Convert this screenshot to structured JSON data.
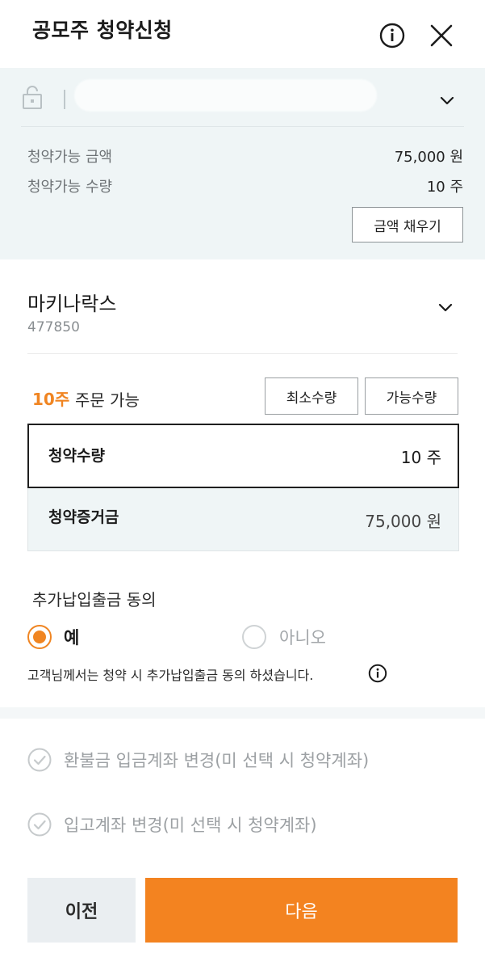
{
  "header": {
    "title": "공모주 청약신청",
    "info_icon": "info-circle-icon",
    "close_icon": "close-icon"
  },
  "account": {
    "icon": "lock-icon",
    "chevron": "chevron-down-icon",
    "rows": [
      {
        "label": "청약가능 금액",
        "value": "75,000 원"
      },
      {
        "label": "청약가능 수량",
        "value": "10 주"
      }
    ],
    "fill_button": "금액 채우기"
  },
  "stock": {
    "name": "마키나락스",
    "code": "477850",
    "chevron": "chevron-down-icon"
  },
  "order": {
    "available_qty": "10주",
    "available_text": "주문 가능",
    "min_button": "최소수량",
    "max_button": "가능수량",
    "quantity_label": "청약수량",
    "quantity_value": "10 주",
    "deposit_label": "청약증거금",
    "deposit_value": "75,000 원"
  },
  "consent": {
    "title": "추가납입출금 동의",
    "yes": "예",
    "no": "아니오",
    "selected": "예",
    "note": "고객님께서는 청약 시 추가납입출금 동의 하셨습니다.",
    "note_icon": "info-circle-icon"
  },
  "options": [
    {
      "label": "환불금 입금계좌 변경(미 선택 시 청약계좌)",
      "icon": "check-circle-icon"
    },
    {
      "label": "입고계좌 변경(미 선택 시 청약계좌)",
      "icon": "check-circle-icon"
    }
  ],
  "footer": {
    "prev": "이전",
    "next": "다음"
  },
  "colors": {
    "accent": "#f38320",
    "panel_bg": "#eff5f6"
  }
}
